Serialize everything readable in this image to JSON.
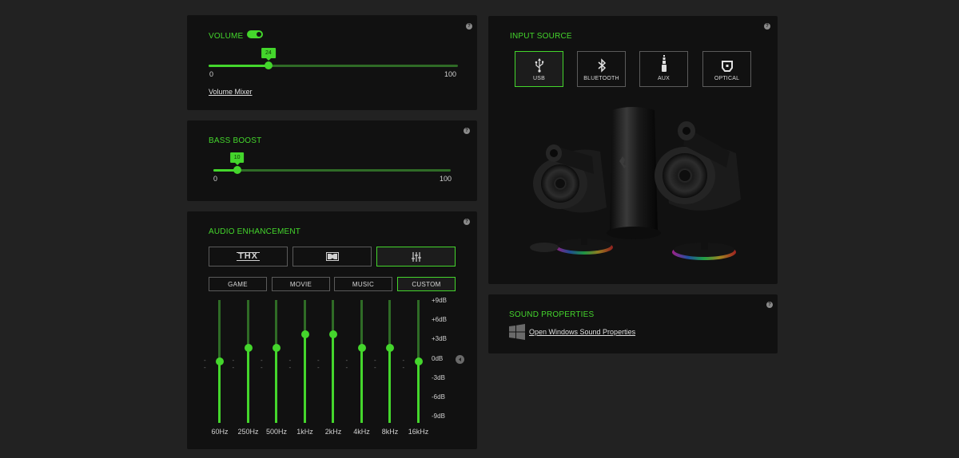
{
  "volume": {
    "title": "VOLUME",
    "enabled": true,
    "value": 24,
    "value_label": "24",
    "min_label": "0",
    "max_label": "100",
    "mixer_link": "Volume Mixer",
    "help": "?"
  },
  "bass_boost": {
    "title": "BASS BOOST",
    "value": 10,
    "value_label": "10",
    "min_label": "0",
    "max_label": "100",
    "help": "?"
  },
  "audio_enhancement": {
    "title": "AUDIO ENHANCEMENT",
    "help": "?",
    "modes": [
      {
        "id": "thx",
        "label": "THX",
        "active": false
      },
      {
        "id": "dolby",
        "icon": "dolby-icon",
        "active": false
      },
      {
        "id": "equalizer",
        "icon": "equalizer-sliders-icon",
        "active": true
      }
    ],
    "presets": [
      {
        "label": "GAME",
        "active": false
      },
      {
        "label": "MOVIE",
        "active": false
      },
      {
        "label": "MUSIC",
        "active": false
      },
      {
        "label": "CUSTOM",
        "active": true
      }
    ],
    "db_labels": [
      "+9dB",
      "+6dB",
      "+3dB",
      "0dB",
      "-3dB",
      "-6dB",
      "-9dB"
    ],
    "bands": [
      {
        "freq": "60Hz",
        "gain": 0
      },
      {
        "freq": "250Hz",
        "gain": 2
      },
      {
        "freq": "500Hz",
        "gain": 2
      },
      {
        "freq": "1kHz",
        "gain": 4
      },
      {
        "freq": "2kHz",
        "gain": 4
      },
      {
        "freq": "4kHz",
        "gain": 2
      },
      {
        "freq": "8kHz",
        "gain": 2
      },
      {
        "freq": "16kHz",
        "gain": 0
      }
    ],
    "reset_icon": "reset-icon"
  },
  "input_source": {
    "title": "INPUT SOURCE",
    "help": "?",
    "sources": [
      {
        "label": "USB",
        "icon": "usb-icon",
        "active": true
      },
      {
        "label": "BLUETOOTH",
        "icon": "bluetooth-icon",
        "active": false
      },
      {
        "label": "AUX",
        "icon": "aux-jack-icon",
        "active": false
      },
      {
        "label": "OPTICAL",
        "icon": "optical-icon",
        "active": false
      }
    ],
    "image": "speaker-system-image"
  },
  "sound_properties": {
    "title": "SOUND PROPERTIES",
    "help": "?",
    "link": "Open Windows Sound Properties",
    "icon": "windows-logo-icon"
  },
  "colors": {
    "accent": "#44d62c",
    "track": "#2f6b26",
    "panel": "#111111",
    "background": "#222222"
  }
}
